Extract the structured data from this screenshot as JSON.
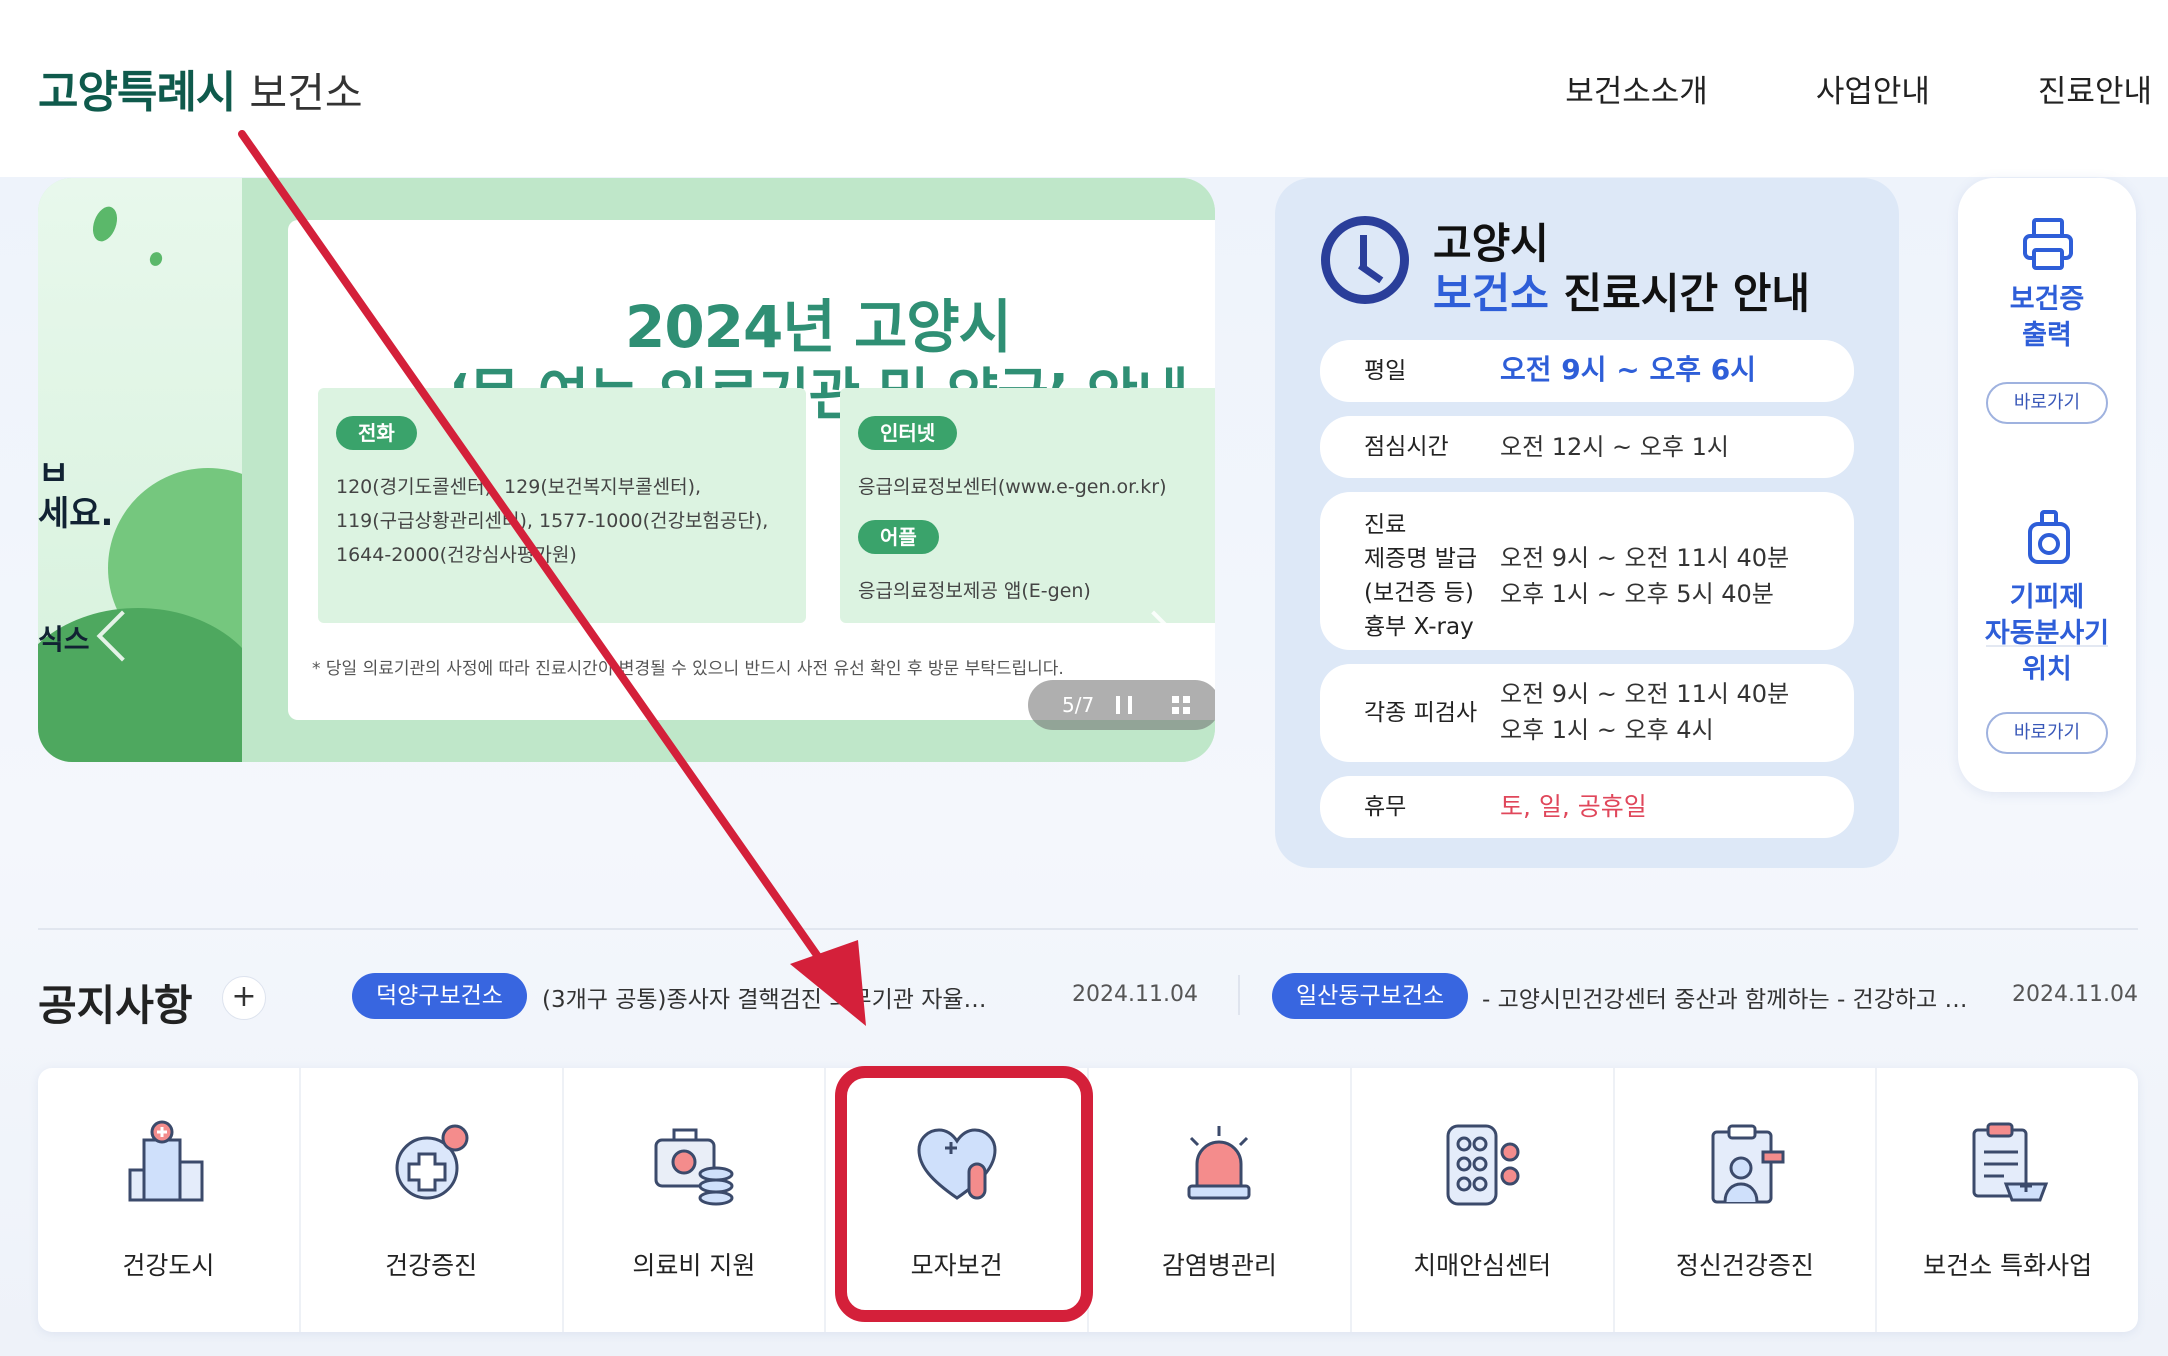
{
  "header": {
    "logo_main": "고양특례시",
    "logo_sub": "보건소",
    "nav": [
      "보건소소개",
      "사업안내",
      "진료안내"
    ]
  },
  "banner": {
    "title_line1": "2024년 고양시",
    "title_line2": "‘문 여는 의료기관 및 약국’ 안내",
    "partial_text": [
      "ㅂ",
      "세요.",
      "식스"
    ],
    "phone_label": "전화",
    "phone_lines": [
      "120(경기도콜센터), 129(보건복지부콜센터),",
      "119(구급상황관리센터), 1577-1000(건강보험공단),",
      "1644-2000(건강심사평가원)"
    ],
    "internet_label": "인터넷",
    "internet_line": "응급의료정보센터(www.e-gen.or.kr)",
    "app_label": "어플",
    "app_line": "응급의료정보제공 앱(E-gen)",
    "notice": "* 당일 의료기관의 사정에 따라 진료시간이 변경될 수 있으니 반드시 사전 유선 확인 후 방문 부탁드립니다.",
    "slide_count": "5/7"
  },
  "hours": {
    "title_line1": "고양시",
    "title_line2_blue": "보건소",
    "title_line2_rest": " 진료시간 안내",
    "rows": [
      {
        "label": "평일",
        "value": "오전 9시 ~ 오후 6시"
      },
      {
        "label": "점심시간",
        "value": "오전 12시 ~ 오후 1시"
      },
      {
        "label_lines": [
          "진료",
          "제증명 발급",
          "(보건증 등)",
          "흉부 X-ray"
        ],
        "value_lines": [
          "오전 9시 ~ 오전 11시 40분",
          "오후 1시 ~ 오후 5시 40분"
        ]
      },
      {
        "label": "각종 피검사",
        "value_lines": [
          "오전 9시 ~ 오전 11시 40분",
          "오후 1시 ~ 오후 4시"
        ]
      },
      {
        "label": "휴무",
        "value": "토, 일, 공휴일"
      }
    ]
  },
  "side": {
    "item1_lines": [
      "보건증",
      "출력"
    ],
    "item1_button": "바로가기",
    "item2_lines": [
      "기피제",
      "자동분사기",
      "위치"
    ],
    "item2_button": "바로가기"
  },
  "notices": {
    "title": "공지사항",
    "plus": "+",
    "items": [
      {
        "badge": "덕양구보건소",
        "text": "(3개구 공통)종사자 결핵검진 의무기관 자율…",
        "date": "2024.11.04"
      },
      {
        "badge": "일산동구보건소",
        "text": "- 고양시민건강센터 중산과 함께하는 - 건강하고 …",
        "date": "2024.11.04"
      }
    ]
  },
  "categories": [
    {
      "label": "건강도시",
      "icon": "building-icon"
    },
    {
      "label": "건강증진",
      "icon": "health-plus-icon"
    },
    {
      "label": "의료비 지원",
      "icon": "medical-cost-icon"
    },
    {
      "label": "모자보건",
      "icon": "heart-pill-icon"
    },
    {
      "label": "감염병관리",
      "icon": "siren-icon"
    },
    {
      "label": "치매안심센터",
      "icon": "pill-board-icon"
    },
    {
      "label": "정신건강증진",
      "icon": "doctor-clipboard-icon"
    },
    {
      "label": "보건소 특화사업",
      "icon": "clipboard-plus-icon"
    }
  ],
  "colors": {
    "brand": "#0f5a4c",
    "accent": "#2e5ed8",
    "annotation": "#d4203a"
  }
}
